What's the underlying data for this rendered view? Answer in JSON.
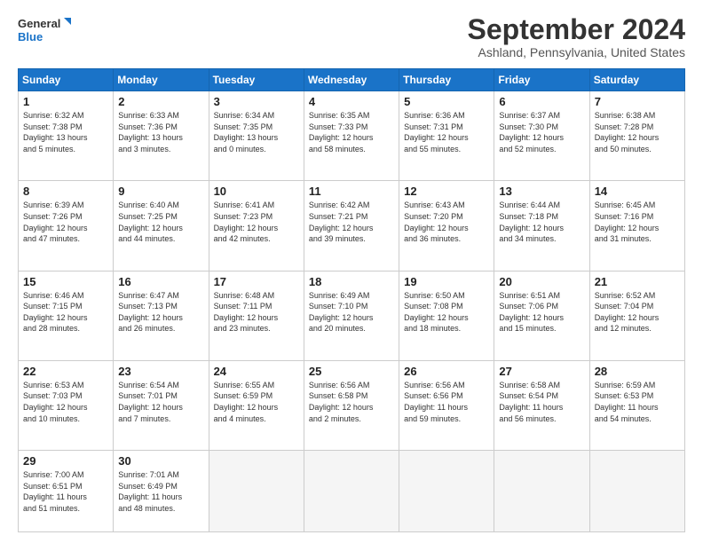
{
  "logo": {
    "line1": "General",
    "line2": "Blue"
  },
  "title": "September 2024",
  "subtitle": "Ashland, Pennsylvania, United States",
  "days_of_week": [
    "Sunday",
    "Monday",
    "Tuesday",
    "Wednesday",
    "Thursday",
    "Friday",
    "Saturday"
  ],
  "weeks": [
    [
      {
        "num": "1",
        "sunrise": "6:32 AM",
        "sunset": "7:38 PM",
        "daylight": "13 hours and 5 minutes."
      },
      {
        "num": "2",
        "sunrise": "6:33 AM",
        "sunset": "7:36 PM",
        "daylight": "13 hours and 3 minutes."
      },
      {
        "num": "3",
        "sunrise": "6:34 AM",
        "sunset": "7:35 PM",
        "daylight": "13 hours and 0 minutes."
      },
      {
        "num": "4",
        "sunrise": "6:35 AM",
        "sunset": "7:33 PM",
        "daylight": "12 hours and 58 minutes."
      },
      {
        "num": "5",
        "sunrise": "6:36 AM",
        "sunset": "7:31 PM",
        "daylight": "12 hours and 55 minutes."
      },
      {
        "num": "6",
        "sunrise": "6:37 AM",
        "sunset": "7:30 PM",
        "daylight": "12 hours and 52 minutes."
      },
      {
        "num": "7",
        "sunrise": "6:38 AM",
        "sunset": "7:28 PM",
        "daylight": "12 hours and 50 minutes."
      }
    ],
    [
      {
        "num": "8",
        "sunrise": "6:39 AM",
        "sunset": "7:26 PM",
        "daylight": "12 hours and 47 minutes."
      },
      {
        "num": "9",
        "sunrise": "6:40 AM",
        "sunset": "7:25 PM",
        "daylight": "12 hours and 44 minutes."
      },
      {
        "num": "10",
        "sunrise": "6:41 AM",
        "sunset": "7:23 PM",
        "daylight": "12 hours and 42 minutes."
      },
      {
        "num": "11",
        "sunrise": "6:42 AM",
        "sunset": "7:21 PM",
        "daylight": "12 hours and 39 minutes."
      },
      {
        "num": "12",
        "sunrise": "6:43 AM",
        "sunset": "7:20 PM",
        "daylight": "12 hours and 36 minutes."
      },
      {
        "num": "13",
        "sunrise": "6:44 AM",
        "sunset": "7:18 PM",
        "daylight": "12 hours and 34 minutes."
      },
      {
        "num": "14",
        "sunrise": "6:45 AM",
        "sunset": "7:16 PM",
        "daylight": "12 hours and 31 minutes."
      }
    ],
    [
      {
        "num": "15",
        "sunrise": "6:46 AM",
        "sunset": "7:15 PM",
        "daylight": "12 hours and 28 minutes."
      },
      {
        "num": "16",
        "sunrise": "6:47 AM",
        "sunset": "7:13 PM",
        "daylight": "12 hours and 26 minutes."
      },
      {
        "num": "17",
        "sunrise": "6:48 AM",
        "sunset": "7:11 PM",
        "daylight": "12 hours and 23 minutes."
      },
      {
        "num": "18",
        "sunrise": "6:49 AM",
        "sunset": "7:10 PM",
        "daylight": "12 hours and 20 minutes."
      },
      {
        "num": "19",
        "sunrise": "6:50 AM",
        "sunset": "7:08 PM",
        "daylight": "12 hours and 18 minutes."
      },
      {
        "num": "20",
        "sunrise": "6:51 AM",
        "sunset": "7:06 PM",
        "daylight": "12 hours and 15 minutes."
      },
      {
        "num": "21",
        "sunrise": "6:52 AM",
        "sunset": "7:04 PM",
        "daylight": "12 hours and 12 minutes."
      }
    ],
    [
      {
        "num": "22",
        "sunrise": "6:53 AM",
        "sunset": "7:03 PM",
        "daylight": "12 hours and 10 minutes."
      },
      {
        "num": "23",
        "sunrise": "6:54 AM",
        "sunset": "7:01 PM",
        "daylight": "12 hours and 7 minutes."
      },
      {
        "num": "24",
        "sunrise": "6:55 AM",
        "sunset": "6:59 PM",
        "daylight": "12 hours and 4 minutes."
      },
      {
        "num": "25",
        "sunrise": "6:56 AM",
        "sunset": "6:58 PM",
        "daylight": "12 hours and 2 minutes."
      },
      {
        "num": "26",
        "sunrise": "6:56 AM",
        "sunset": "6:56 PM",
        "daylight": "11 hours and 59 minutes."
      },
      {
        "num": "27",
        "sunrise": "6:58 AM",
        "sunset": "6:54 PM",
        "daylight": "11 hours and 56 minutes."
      },
      {
        "num": "28",
        "sunrise": "6:59 AM",
        "sunset": "6:53 PM",
        "daylight": "11 hours and 54 minutes."
      }
    ],
    [
      {
        "num": "29",
        "sunrise": "7:00 AM",
        "sunset": "6:51 PM",
        "daylight": "11 hours and 51 minutes."
      },
      {
        "num": "30",
        "sunrise": "7:01 AM",
        "sunset": "6:49 PM",
        "daylight": "11 hours and 48 minutes."
      },
      null,
      null,
      null,
      null,
      null
    ]
  ],
  "labels": {
    "sunrise": "Sunrise:",
    "sunset": "Sunset:",
    "daylight": "Daylight hours"
  }
}
